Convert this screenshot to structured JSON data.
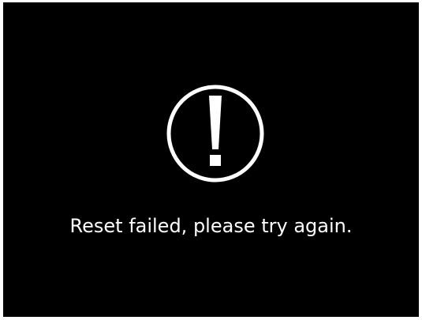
{
  "dialog": {
    "icon": "exclamation-circle-icon",
    "message": "Reset failed, please try again."
  },
  "colors": {
    "background": "#000000",
    "foreground": "#ffffff"
  }
}
